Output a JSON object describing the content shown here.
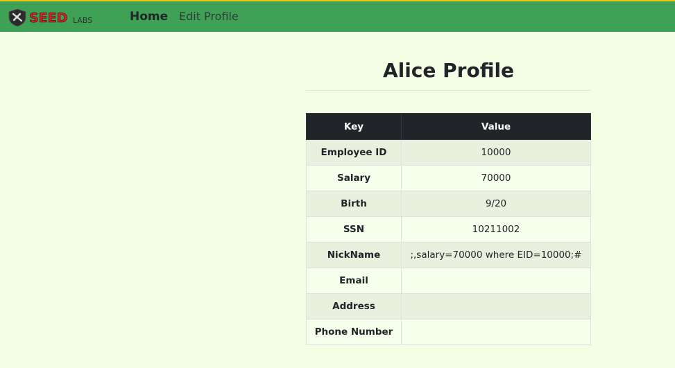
{
  "nav": {
    "logo_text": "SEEDLABS",
    "home_label": "Home",
    "edit_profile_label": "Edit Profile"
  },
  "page": {
    "title": "Alice Profile"
  },
  "table": {
    "headers": [
      "Key",
      "Value"
    ],
    "rows": [
      {
        "key": "Employee ID",
        "value": "10000"
      },
      {
        "key": "Salary",
        "value": "70000"
      },
      {
        "key": "Birth",
        "value": "9/20"
      },
      {
        "key": "SSN",
        "value": "10211002"
      },
      {
        "key": "NickName",
        "value": ";,salary=70000 where EID=10000;#"
      },
      {
        "key": "Email",
        "value": ""
      },
      {
        "key": "Address",
        "value": ""
      },
      {
        "key": "Phone Number",
        "value": ""
      }
    ]
  },
  "colors": {
    "navbar": "#3fa155",
    "background": "#f3fee5",
    "table_header": "#212529"
  }
}
